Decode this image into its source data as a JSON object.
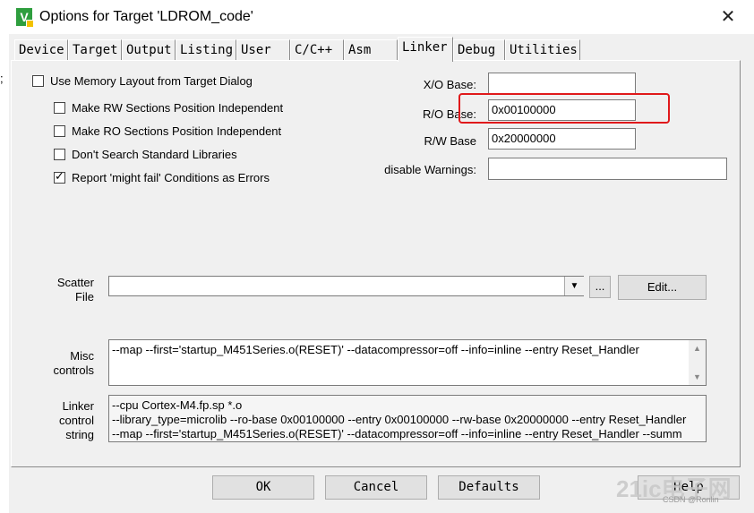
{
  "window": {
    "title": "Options for Target 'LDROM_code'",
    "close_glyph": "✕",
    "icon_glyph": "V"
  },
  "behind": {
    "semicolon": ";"
  },
  "tabs": [
    "Device",
    "Target",
    "Output",
    "Listing",
    "User",
    "C/C++",
    "Asm",
    "Linker",
    "Debug",
    "Utilities"
  ],
  "active_tab": "Linker",
  "options": {
    "use_memory_layout": {
      "label": "Use Memory Layout from Target Dialog",
      "checked": false
    },
    "make_rw_pi": {
      "label": "Make RW Sections Position Independent",
      "checked": false
    },
    "make_ro_pi": {
      "label": "Make RO Sections Position Independent",
      "checked": false
    },
    "dont_search_std_libs": {
      "label": "Don't Search Standard Libraries",
      "checked": false
    },
    "report_might_fail": {
      "label": "Report 'might fail' Conditions as Errors",
      "checked": true
    }
  },
  "fields": {
    "xo_base": {
      "label": "X/O Base:",
      "value": ""
    },
    "ro_base": {
      "label": "R/O Base:",
      "value": "0x00100000"
    },
    "rw_base": {
      "label": "R/W Base",
      "value": "0x20000000"
    },
    "disable_warnings": {
      "label": "disable Warnings:",
      "value": ""
    }
  },
  "scatter": {
    "label_line1": "Scatter",
    "label_line2": "File",
    "value": "",
    "browse_label": "...",
    "edit_label": "Edit..."
  },
  "misc": {
    "label_line1": "Misc",
    "label_line2": "controls",
    "text": "--map --first='startup_M451Series.o(RESET)' --datacompressor=off --info=inline --entry Reset_Handler"
  },
  "linker_control": {
    "label_line1": "Linker",
    "label_line2": "control",
    "label_line3": "string",
    "lines": [
      "--cpu Cortex-M4.fp.sp *.o",
      "--library_type=microlib --ro-base 0x00100000 --entry 0x00100000 --rw-base 0x20000000 --entry Reset_Handler",
      "--map --first='startup_M451Series.o(RESET)' --datacompressor=off --info=inline --entry Reset_Handler --summ"
    ]
  },
  "buttons": {
    "ok": "OK",
    "cancel": "Cancel",
    "defaults": "Defaults",
    "help": "Help"
  },
  "watermark": {
    "main": "21ic电子网",
    "sub": "CSDN @Ronlin"
  },
  "colors": {
    "highlight": "#e0191b",
    "dialog_bg": "#f0f0f0"
  }
}
